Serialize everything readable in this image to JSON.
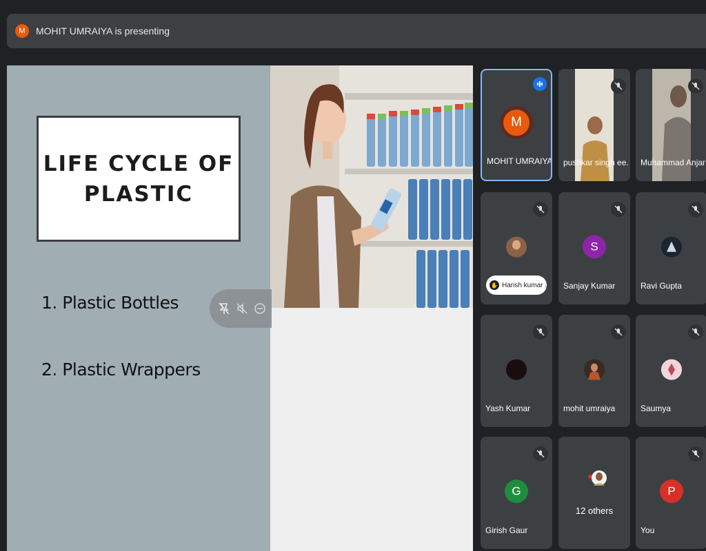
{
  "banner": {
    "initial": "M",
    "text": "MOHIT UMRAIYA is presenting",
    "avatar_color": "#e8590c"
  },
  "slide": {
    "title": "LIFE CYCLE OF\nPLASTIC",
    "points": [
      "1. Plastic Bottles",
      "2. Plastic Wrappers"
    ],
    "image": "woman-shopping-water-bottles-photo"
  },
  "presentation_controls": [
    "pin-icon",
    "mute-icon",
    "more-icon"
  ],
  "participants": [
    {
      "name": "MOHIT UMRAIYA",
      "initial": "M",
      "color": "#e8590c",
      "state": "speaking"
    },
    {
      "name": "pushkar singh ee...",
      "state": "video",
      "mic": "muted"
    },
    {
      "name": "Muhammad Anjar",
      "state": "video",
      "mic": "muted"
    },
    {
      "name": "Harish kumar ...",
      "state": "photo",
      "mic": "muted",
      "hand_raised": true
    },
    {
      "name": "Sanjay Kumar",
      "initial": "S",
      "color": "#8e24aa",
      "mic": "muted"
    },
    {
      "name": "Ravi Gupta",
      "state": "photo",
      "mic": "muted"
    },
    {
      "name": "Yash Kumar",
      "state": "photo",
      "mic": "muted"
    },
    {
      "name": "mohit umraiya",
      "state": "photo",
      "mic": "muted"
    },
    {
      "name": "Saumya",
      "state": "photo",
      "mic": "muted"
    },
    {
      "name": "Girish Gaur",
      "initial": "G",
      "color": "#1e8e3e",
      "mic": "muted"
    },
    {
      "name": "",
      "others_label": "12 others",
      "state": "others"
    },
    {
      "name": "You",
      "initial": "P",
      "color": "#d93025",
      "mic": "muted"
    }
  ]
}
